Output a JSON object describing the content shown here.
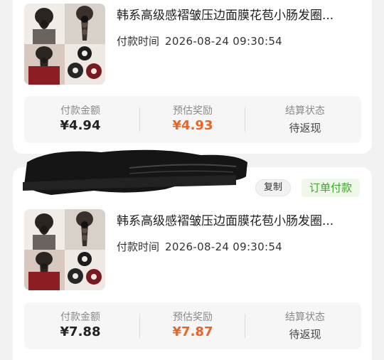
{
  "orders": [
    {
      "product_title": "韩系高级感褶皱压边面膜花苞小肠发圈...",
      "pay_time_label": "付款时间",
      "pay_time_value": "2026-08-24 09:30:54",
      "stats": {
        "paid_label": "付款金额",
        "paid_value": "¥4.94",
        "reward_label": "预估奖励",
        "reward_value": "¥4.93",
        "settle_label": "结算状态",
        "settle_value": "待返现"
      }
    },
    {
      "copy_label": "复制",
      "order_status": "订单付款",
      "product_title": "韩系高级感褶皱压边面膜花苞小肠发圈...",
      "pay_time_label": "付款时间",
      "pay_time_value": "2026-08-24 09:30:54",
      "stats": {
        "paid_label": "付款金额",
        "paid_value": "¥7.88",
        "reward_label": "预估奖励",
        "reward_value": "¥7.87",
        "settle_label": "结算状态",
        "settle_value": "待返现"
      }
    }
  ],
  "colors": {
    "reward": "#e8652a",
    "order_status": "#3ea62f",
    "order_status_bg": "#eef8e9"
  },
  "icons": {
    "product_image": "hair-scrunchie-product-image",
    "redaction": "redacted-order-number"
  }
}
